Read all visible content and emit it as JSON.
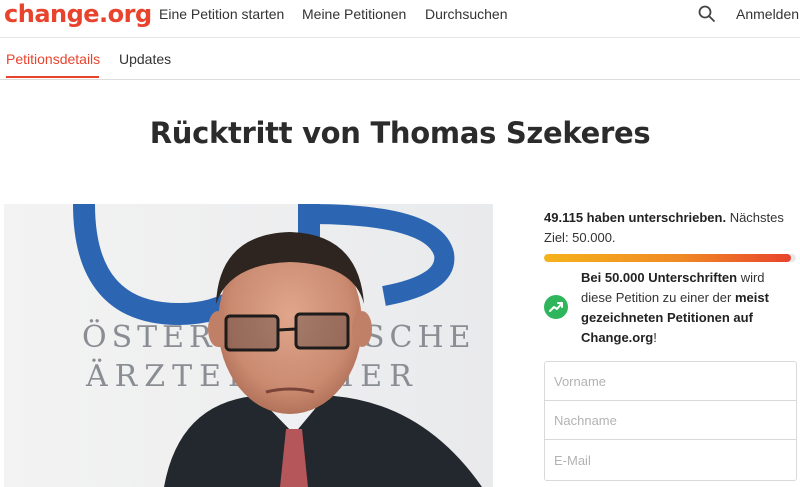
{
  "brand": {
    "logo": "change.org",
    "accent": "#e8432d"
  },
  "nav": {
    "start_petition": "Eine Petition starten",
    "my_petitions": "Meine Petitionen",
    "browse": "Durchsuchen",
    "search_icon": "search-icon",
    "login": "Anmelden"
  },
  "tabs": [
    {
      "label": "Petitionsdetails",
      "active": true
    },
    {
      "label": "Updates",
      "active": false
    }
  ],
  "petition": {
    "title": "Rücktritt von Thomas Szekeres",
    "photo_signage": {
      "line1": "ÖSTERREICHISCHE",
      "line2": "ÄRZTEKAMMER"
    }
  },
  "signatures": {
    "count_text": "49.115 haben unterschrieben.",
    "next_goal_text": " Nächstes Ziel: 50.000.",
    "progress_fraction": 0.982
  },
  "goal_message": {
    "icon": "trending-up-icon",
    "part1_bold": "Bei 50.000 Unterschriften",
    "part2": " wird diese Petition zu einer der ",
    "part3_bold": "meist gezeichneten Petitionen auf Change.org",
    "part4": "!"
  },
  "form": {
    "first_name_placeholder": "Vorname",
    "last_name_placeholder": "Nachname",
    "email_placeholder": "E-Mail"
  }
}
